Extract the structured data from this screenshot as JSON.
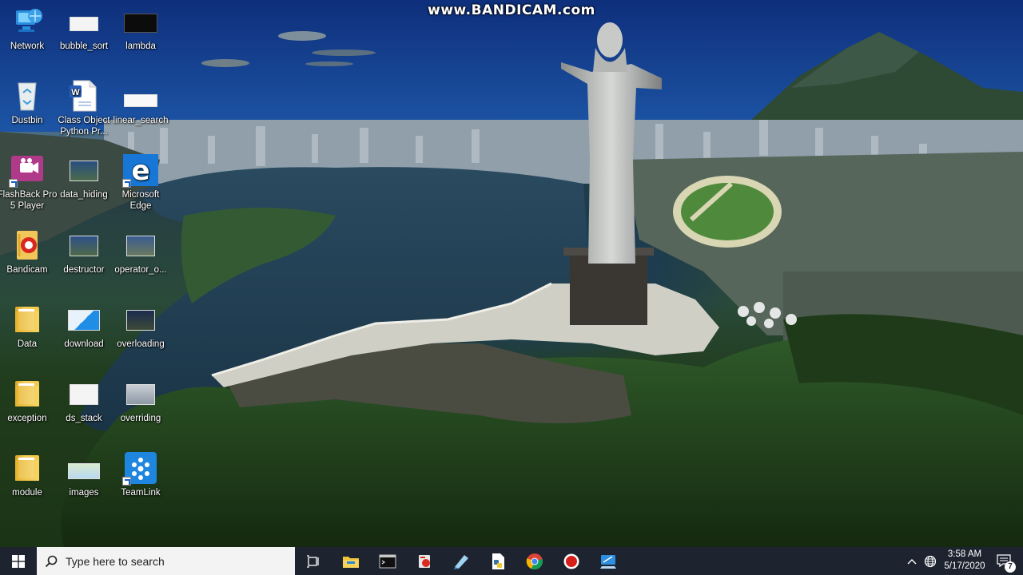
{
  "watermark": "www.BANDICAM.com",
  "desktop_icons": [
    {
      "label": "Network",
      "icon": "network-icon"
    },
    {
      "label": "bubble_sort",
      "icon": "document-thumbnail-icon"
    },
    {
      "label": "lambda",
      "icon": "code-thumbnail-icon"
    },
    {
      "label": "Dustbin",
      "icon": "recycle-bin-icon"
    },
    {
      "label": "Class Object Python Pr...",
      "icon": "word-document-icon"
    },
    {
      "label": "linear_search",
      "icon": "document-thumbnail-icon"
    },
    {
      "label": "FlashBack Pro 5 Player",
      "icon": "flashback-player-icon"
    },
    {
      "label": "data_hiding",
      "icon": "video-thumbnail-icon"
    },
    {
      "label": "Microsoft Edge",
      "icon": "edge-icon"
    },
    {
      "label": "Bandicam",
      "icon": "bandicam-icon"
    },
    {
      "label": "destructor",
      "icon": "video-thumbnail-icon"
    },
    {
      "label": "operator_o...",
      "icon": "video-thumbnail-icon"
    },
    {
      "label": "Data",
      "icon": "folder-icon"
    },
    {
      "label": "download",
      "icon": "image-thumbnail-icon"
    },
    {
      "label": "overloading",
      "icon": "video-thumbnail-icon"
    },
    {
      "label": "exception",
      "icon": "folder-icon"
    },
    {
      "label": "ds_stack",
      "icon": "document-thumbnail-icon"
    },
    {
      "label": "overriding",
      "icon": "video-thumbnail-icon"
    },
    {
      "label": "module",
      "icon": "folder-icon"
    },
    {
      "label": "images",
      "icon": "image-thumbnail-icon"
    },
    {
      "label": "TeamLink",
      "icon": "teamlink-icon"
    }
  ],
  "taskbar": {
    "search_placeholder": "Type here to search",
    "pinned": [
      "task-view-icon",
      "file-explorer-icon",
      "terminal-icon",
      "app-icon",
      "notepad-icon",
      "python-file-icon",
      "chrome-icon",
      "record-icon",
      "app-icon"
    ],
    "time": "3:58 AM",
    "date": "5/17/2020",
    "notification_count": "7"
  },
  "colors": {
    "taskbar": "#1d2430",
    "search_box": "#f3f3f3",
    "accent": "#0078d7"
  }
}
